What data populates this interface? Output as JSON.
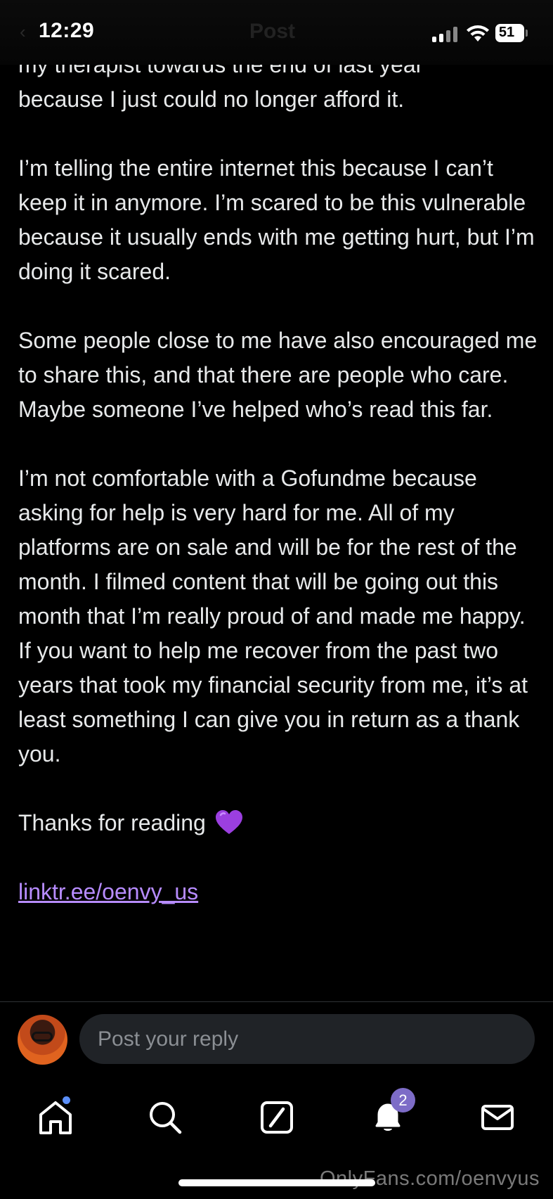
{
  "status_bar": {
    "time": "12:29",
    "battery": "51",
    "faded_back": "‹",
    "faded_title": "Post"
  },
  "post": {
    "partial_line_1": "my therapist towards the end of last year",
    "partial_line_2": "because I just could no longer afford it.",
    "paragraphs": [
      "I’m telling the entire internet this because I can’t keep it in anymore. I’m scared to be this vulnerable because it usually ends with me getting hurt, but I’m doing it scared.",
      "Some people close to me have also encouraged me to share this, and that there are people who care. Maybe someone I’ve helped who’s read this far.",
      "I’m not comfortable with a Gofundme because asking for help is very hard for me. All of my platforms are on sale and will be for the rest of the month. I filmed content that will be going out this month that I’m really proud of and made me happy. If you want to help me recover from the past two years that took my financial security from me, it’s at least something I can give you in return as a thank you."
    ],
    "thanks": "Thanks for reading",
    "thanks_icon": "purple-heart-icon",
    "link_text": "linktr.ee/oenvy_us"
  },
  "reply": {
    "placeholder": "Post your reply"
  },
  "tab_bar": {
    "notification_count": "2",
    "accent_dot_color": "#5b8ff9",
    "badge_color": "#7d6cc7"
  },
  "watermark": "OnlyFans.com/oenvyus",
  "colors": {
    "link": "#b78cff",
    "heart": "#9b3fe0",
    "reply_input_bg": "#202327"
  }
}
